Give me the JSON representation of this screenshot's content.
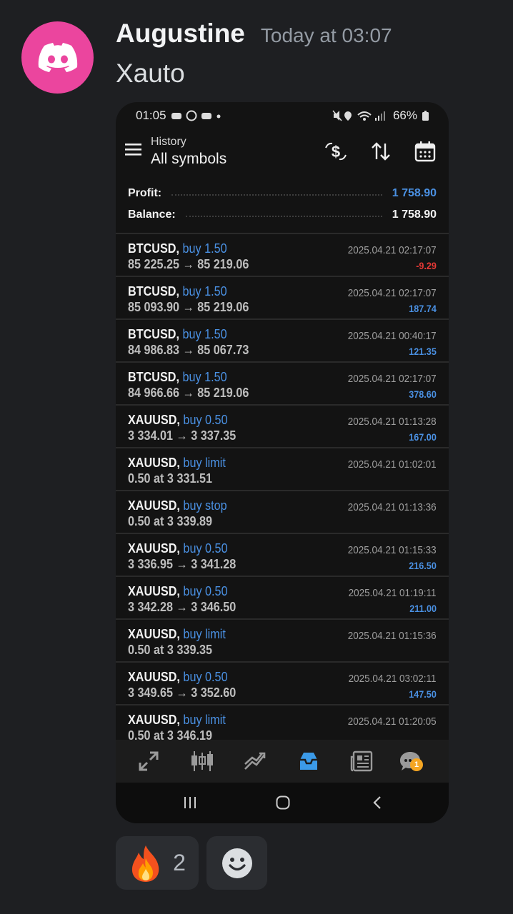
{
  "message": {
    "author": "Augustine",
    "timestamp": "Today at 03:07",
    "text": "Xauto"
  },
  "phone": {
    "status": {
      "time": "01:05",
      "battery": "66%"
    },
    "header": {
      "subtitle": "History",
      "title": "All symbols"
    },
    "summary": {
      "profit_label": "Profit:",
      "profit_value": "1 758.90",
      "balance_label": "Balance:",
      "balance_value": "1 758.90"
    },
    "rows": [
      {
        "symbol": "BTCUSD,",
        "side": "buy 1.50",
        "prices": "85 225.25 → 85 219.06",
        "datetime": "2025.04.21 02:17:07",
        "profit": "-9.29",
        "negative": true
      },
      {
        "symbol": "BTCUSD,",
        "side": "buy 1.50",
        "prices": "85 093.90 → 85 219.06",
        "datetime": "2025.04.21 02:17:07",
        "profit": "187.74"
      },
      {
        "symbol": "BTCUSD,",
        "side": "buy 1.50",
        "prices": "84 986.83 → 85 067.73",
        "datetime": "2025.04.21 00:40:17",
        "profit": "121.35"
      },
      {
        "symbol": "BTCUSD,",
        "side": "buy 1.50",
        "prices": "84 966.66 → 85 219.06",
        "datetime": "2025.04.21 02:17:07",
        "profit": "378.60"
      },
      {
        "symbol": "XAUUSD,",
        "side": "buy 0.50",
        "prices": "3 334.01 → 3 337.35",
        "datetime": "2025.04.21 01:13:28",
        "profit": "167.00"
      },
      {
        "symbol": "XAUUSD,",
        "side": "buy limit",
        "prices": "0.50 at 3 331.51",
        "datetime": "2025.04.21 01:02:01",
        "profit": ""
      },
      {
        "symbol": "XAUUSD,",
        "side": "buy stop",
        "prices": "0.50 at 3 339.89",
        "datetime": "2025.04.21 01:13:36",
        "profit": ""
      },
      {
        "symbol": "XAUUSD,",
        "side": "buy 0.50",
        "prices": "3 336.95 → 3 341.28",
        "datetime": "2025.04.21 01:15:33",
        "profit": "216.50"
      },
      {
        "symbol": "XAUUSD,",
        "side": "buy 0.50",
        "prices": "3 342.28 → 3 346.50",
        "datetime": "2025.04.21 01:19:11",
        "profit": "211.00"
      },
      {
        "symbol": "XAUUSD,",
        "side": "buy limit",
        "prices": "0.50 at 3 339.35",
        "datetime": "2025.04.21 01:15:36",
        "profit": ""
      },
      {
        "symbol": "XAUUSD,",
        "side": "buy 0.50",
        "prices": "3 349.65 → 3 352.60",
        "datetime": "2025.04.21 03:02:11",
        "profit": "147.50"
      },
      {
        "symbol": "XAUUSD,",
        "side": "buy limit",
        "prices": "0.50 at 3 346.19",
        "datetime": "2025.04.21 01:20:05",
        "profit": ""
      }
    ],
    "nav": {
      "items": [
        "quotes-icon",
        "chart-icon",
        "trade-icon",
        "history-icon",
        "news-icon",
        "messages-icon"
      ],
      "active": "history-icon",
      "badge": "1"
    }
  },
  "reactions": [
    {
      "emoji": "fire-icon",
      "count": "2"
    },
    {
      "emoji": "add-reaction-icon",
      "count": ""
    }
  ],
  "colors": {
    "accent_blue": "#4a90e2",
    "loss_red": "#e53935",
    "avatar_pink": "#eb459e"
  }
}
